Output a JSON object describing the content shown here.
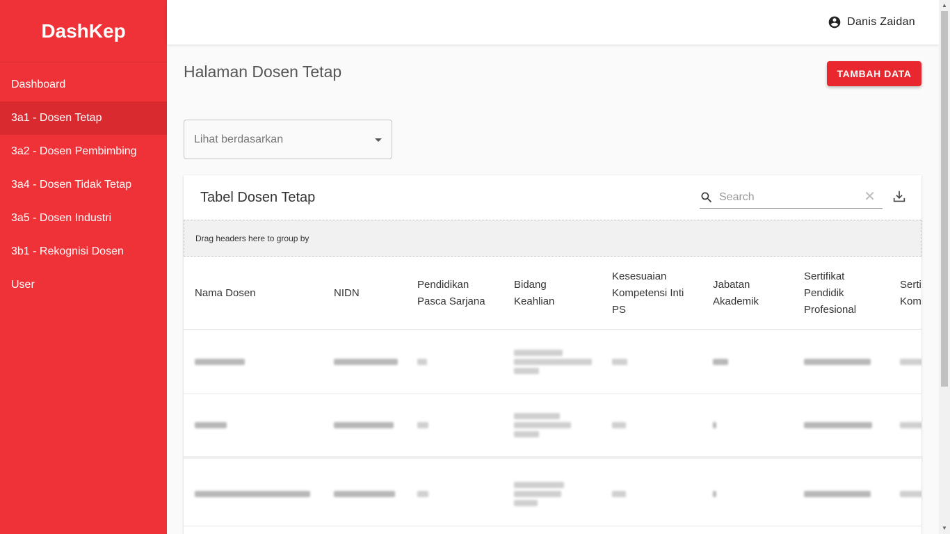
{
  "app": {
    "title": "DashKep"
  },
  "sidebar": {
    "items": [
      {
        "label": "Dashboard",
        "active": false
      },
      {
        "label": "3a1 - Dosen Tetap",
        "active": true
      },
      {
        "label": "3a2 - Dosen Pembimbing",
        "active": false
      },
      {
        "label": "3a4 - Dosen Tidak Tetap",
        "active": false
      },
      {
        "label": "3a5 - Dosen Industri",
        "active": false
      },
      {
        "label": "3b1 - Rekognisi Dosen",
        "active": false
      },
      {
        "label": "User",
        "active": false
      }
    ]
  },
  "header": {
    "user_name": "Danis Zaidan",
    "user_icon": "account-circle-icon"
  },
  "main": {
    "page_title": "Halaman Dosen Tetap",
    "add_button": "TAMBAH DATA",
    "filter_select": {
      "placeholder": "Lihat berdasarkan"
    }
  },
  "table": {
    "title": "Tabel Dosen Tetap",
    "search_placeholder": "Search",
    "group_by_hint": "Drag headers here to group by",
    "columns": [
      "Nama Dosen",
      "NIDN",
      "Pendidikan Pasca Sarjana",
      "Bidang Keahlian",
      "Kesesuaian Kompetensi Inti PS",
      "Jabatan Akademik",
      "Sertifikat Pendidik Profesional",
      "Sertifikat Kompetensi"
    ],
    "rows_note": "cell values are blurred/unreadable in screenshot"
  },
  "colors": {
    "brand": "#ef3237",
    "sidebar_active": "#d92a2f",
    "button": "#e8282e"
  }
}
